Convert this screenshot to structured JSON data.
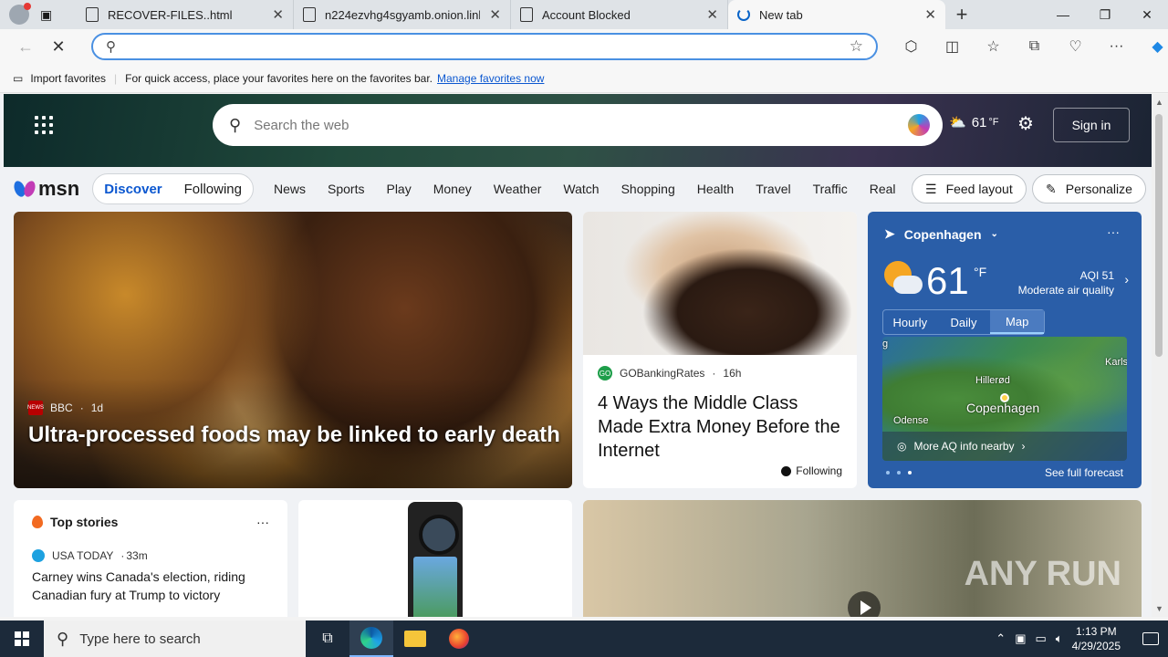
{
  "tabs": [
    {
      "title": "RECOVER-FILES..html",
      "active": false
    },
    {
      "title": "n224ezvhg4sgyamb.onion.link",
      "active": false
    },
    {
      "title": "Account Blocked",
      "active": false
    },
    {
      "title": "New tab",
      "active": true
    }
  ],
  "address_bar": {
    "value": "",
    "placeholder": ""
  },
  "favorites_bar": {
    "import_label": "Import favorites",
    "message": "For quick access, place your favorites here on the favorites bar.",
    "link": "Manage favorites now"
  },
  "msn": {
    "search_placeholder": "Search the web",
    "weather_temp": "61",
    "weather_unit": "°F",
    "sign_in": "Sign in",
    "logo_text": "msn",
    "toggle": {
      "discover": "Discover",
      "following": "Following"
    },
    "categories": [
      "News",
      "Sports",
      "Play",
      "Money",
      "Weather",
      "Watch",
      "Shopping",
      "Health",
      "Travel",
      "Traffic",
      "Real E"
    ],
    "feed_layout": "Feed layout",
    "personalize": "Personalize"
  },
  "hero_story": {
    "source": "BBC",
    "source_badge": "NEWS",
    "age": "1d",
    "headline": "Ultra-processed foods may be linked to early death"
  },
  "story2": {
    "source": "GOBankingRates",
    "source_badge": "GO",
    "age": "16h",
    "headline": "4 Ways the Middle Class Made Extra Money Before the Internet",
    "following": "Following"
  },
  "weather_card": {
    "location": "Copenhagen",
    "temp": "61",
    "unit": "°F",
    "aqi": "AQI 51",
    "aqi_desc": "Moderate air quality",
    "tabs": [
      "Hourly",
      "Daily",
      "Map"
    ],
    "selected_tab": "Map",
    "map_labels": {
      "hillerod": "Hillerød",
      "odense": "Odense",
      "karls": "Karls",
      "g": "g",
      "city": "Copenhagen"
    },
    "more_aq": "More AQ info nearby",
    "forecast_link": "See full forecast"
  },
  "top_stories": {
    "title": "Top stories",
    "source": "USA TODAY",
    "age": "33m",
    "headline": "Carney wins Canada's election, riding Canadian fury at Trump to victory"
  },
  "watermark": "ANY RUN",
  "taskbar": {
    "search_placeholder": "Type here to search",
    "time": "1:13 PM",
    "date": "4/29/2025"
  }
}
